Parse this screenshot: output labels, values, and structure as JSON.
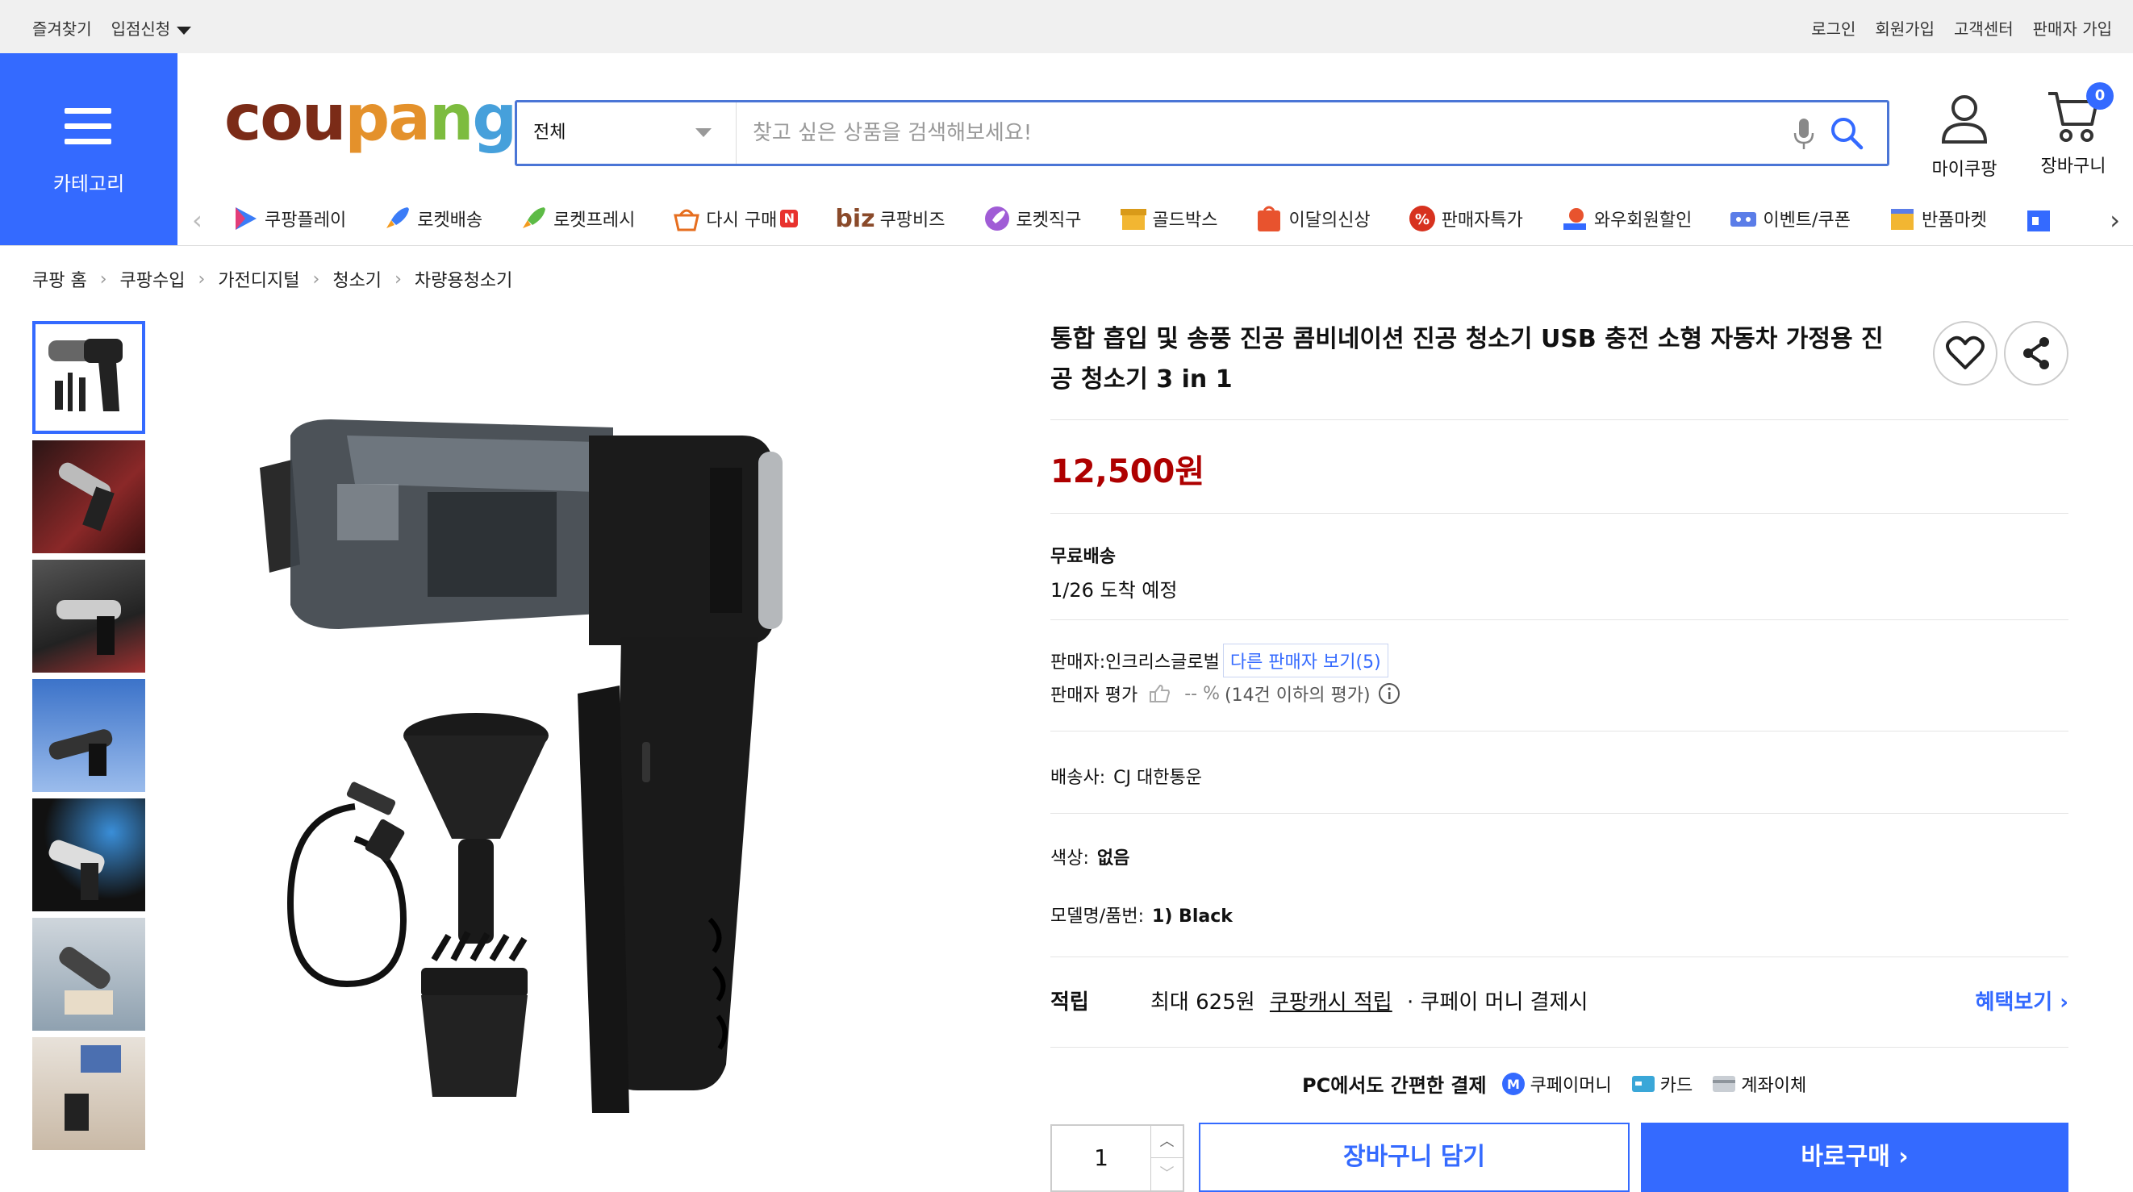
{
  "topbar": {
    "left": [
      "즐겨찾기",
      "입점신청"
    ],
    "right": [
      "로그인",
      "회원가입",
      "고객센터",
      "판매자 가입"
    ]
  },
  "header": {
    "category_label": "카테고리",
    "logo": "coupang",
    "search_category": "전체",
    "search_placeholder": "찾고 싶은 상품을 검색해보세요!",
    "my_coupang": "마이쿠팡",
    "cart_label": "장바구니",
    "cart_count": "0"
  },
  "shortcuts": [
    {
      "label": "쿠팡플레이",
      "icon": "play-icon"
    },
    {
      "label": "로켓배송",
      "icon": "rocket-icon"
    },
    {
      "label": "로켓프레시",
      "icon": "rocket-fresh-icon"
    },
    {
      "label": "다시 구매",
      "icon": "basket-icon"
    },
    {
      "label": "쿠팡비즈",
      "icon": "biz-icon"
    },
    {
      "label": "로켓직구",
      "icon": "rocket-global-icon"
    },
    {
      "label": "골드박스",
      "icon": "goldbox-icon"
    },
    {
      "label": "이달의신상",
      "icon": "new-icon"
    },
    {
      "label": "판매자특가",
      "icon": "percent-icon"
    },
    {
      "label": "와우회원할인",
      "icon": "wow-icon"
    },
    {
      "label": "이벤트/쿠폰",
      "icon": "coupon-icon"
    },
    {
      "label": "반품마켓",
      "icon": "return-market-icon"
    }
  ],
  "shortcut_extra": {
    "n_badge": "N",
    "biz_prefix": "biz"
  },
  "breadcrumb": [
    "쿠팡 홈",
    "쿠팡수입",
    "가전디지털",
    "청소기",
    "차량용청소기"
  ],
  "product": {
    "title": "통합 흡입 및 송풍 진공 콤비네이션 진공 청소기 USB 충전 소형 자동차 가정용 진공 청소기 3 in 1",
    "price": "12,500원",
    "shipping_title": "무료배송",
    "shipping_date": "1/26 도착 예정",
    "seller_label": "판매자:",
    "seller_name": "인크리스글로벌",
    "other_sellers": "다른 판매자 보기(5)",
    "rating_label": "판매자 평가",
    "rating_value": "-- %",
    "rating_count": "(14건 이하의 평가)",
    "courier_label": "배송사:",
    "courier_value": "CJ 대한통운",
    "color_label": "색상:",
    "color_value": "없음",
    "model_label": "모델명/품번:",
    "model_value": "1) Black"
  },
  "points": {
    "label": "적립",
    "text1": "최대 625원",
    "link": "쿠팡캐시 적립",
    "text2": "· 쿠페이 머니 결제시",
    "more": "혜택보기 ›"
  },
  "pay": {
    "head": "PC에서도 간편한 결제",
    "options": [
      "쿠페이머니",
      "카드",
      "계좌이체"
    ]
  },
  "purchase": {
    "quantity": "1",
    "cart_button": "장바구니 담기",
    "buy_button": "바로구매 ›"
  },
  "colors": {
    "brand": "#346aff",
    "price": "#ae0000"
  }
}
